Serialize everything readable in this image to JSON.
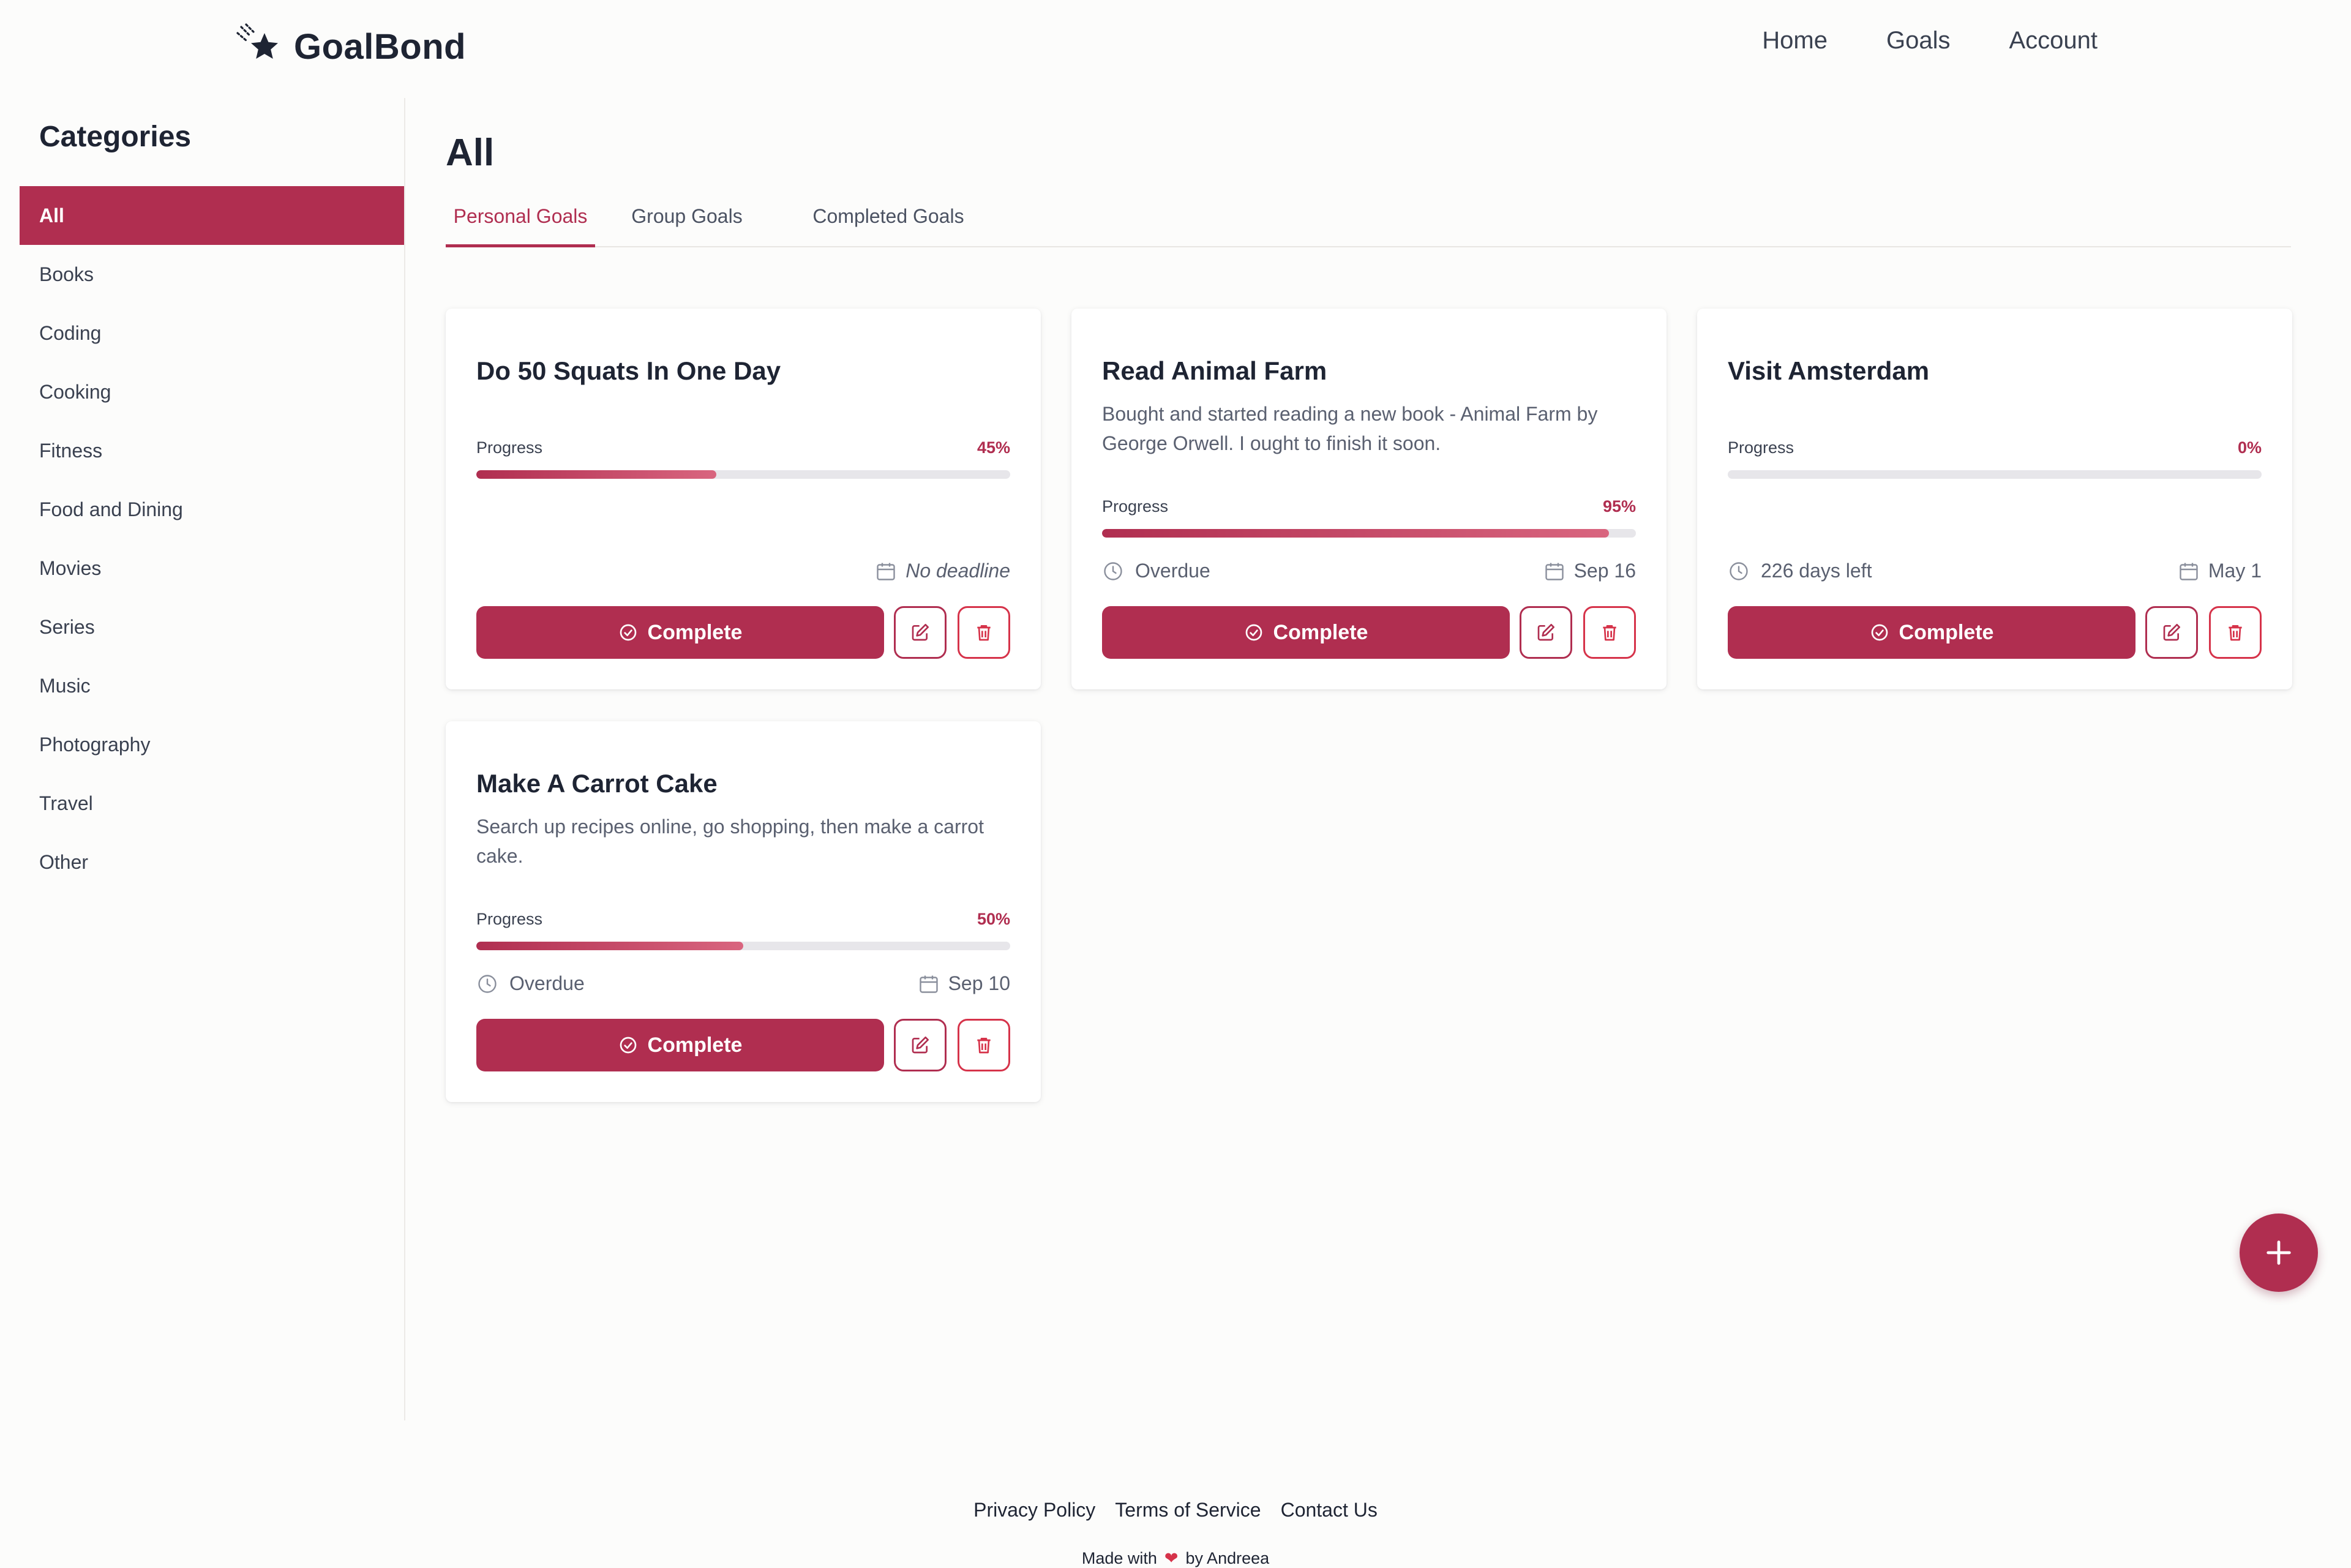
{
  "app": {
    "name": "GoalBond",
    "logo_icon": "shooting-star-icon"
  },
  "nav": {
    "items": [
      "Home",
      "Goals",
      "Account"
    ]
  },
  "sidebar": {
    "title": "Categories",
    "items": [
      "All",
      "Books",
      "Coding",
      "Cooking",
      "Fitness",
      "Food and Dining",
      "Movies",
      "Series",
      "Music",
      "Photography",
      "Travel",
      "Other"
    ],
    "active": "All"
  },
  "main": {
    "title": "All",
    "tabs": [
      "Personal Goals",
      "Group Goals",
      "Completed Goals"
    ],
    "active_tab": "Personal Goals"
  },
  "goals": [
    {
      "title": "Do 50 Squats In One Day",
      "description": "",
      "progress_label": "Progress",
      "progress_text": "45%",
      "progress": 0.45,
      "status": "",
      "deadline": "No deadline",
      "complete_label": "Complete"
    },
    {
      "title": "Read Animal Farm",
      "description": "Bought and started reading a new book - Animal Farm by George Orwell. I ought to finish it soon.",
      "progress_label": "Progress",
      "progress_text": "95%",
      "progress": 0.95,
      "status": "Overdue",
      "deadline": "Sep 16",
      "complete_label": "Complete"
    },
    {
      "title": "Visit Amsterdam",
      "description": "",
      "progress_label": "Progress",
      "progress_text": "0%",
      "progress": 0.0,
      "status": "226 days left",
      "deadline": "May 1",
      "complete_label": "Complete"
    },
    {
      "title": "Make A Carrot Cake",
      "description": "Search up recipes online, go shopping, then make a carrot cake.",
      "progress_label": "Progress",
      "progress_text": "50%",
      "progress": 0.5,
      "status": "Overdue",
      "deadline": "Sep 10",
      "complete_label": "Complete"
    }
  ],
  "fab": {
    "icon": "plus-icon"
  },
  "footer": {
    "links": [
      "Privacy Policy",
      "Terms of Service",
      "Contact Us"
    ],
    "made_with_prefix": "Made with",
    "heart": "❤",
    "made_with_suffix": "by Andreea"
  },
  "colors": {
    "accent": "#b02e50",
    "danger": "#d6334a",
    "text": "#1e2433",
    "muted": "#5a6070",
    "background": "#fcfcfb"
  }
}
